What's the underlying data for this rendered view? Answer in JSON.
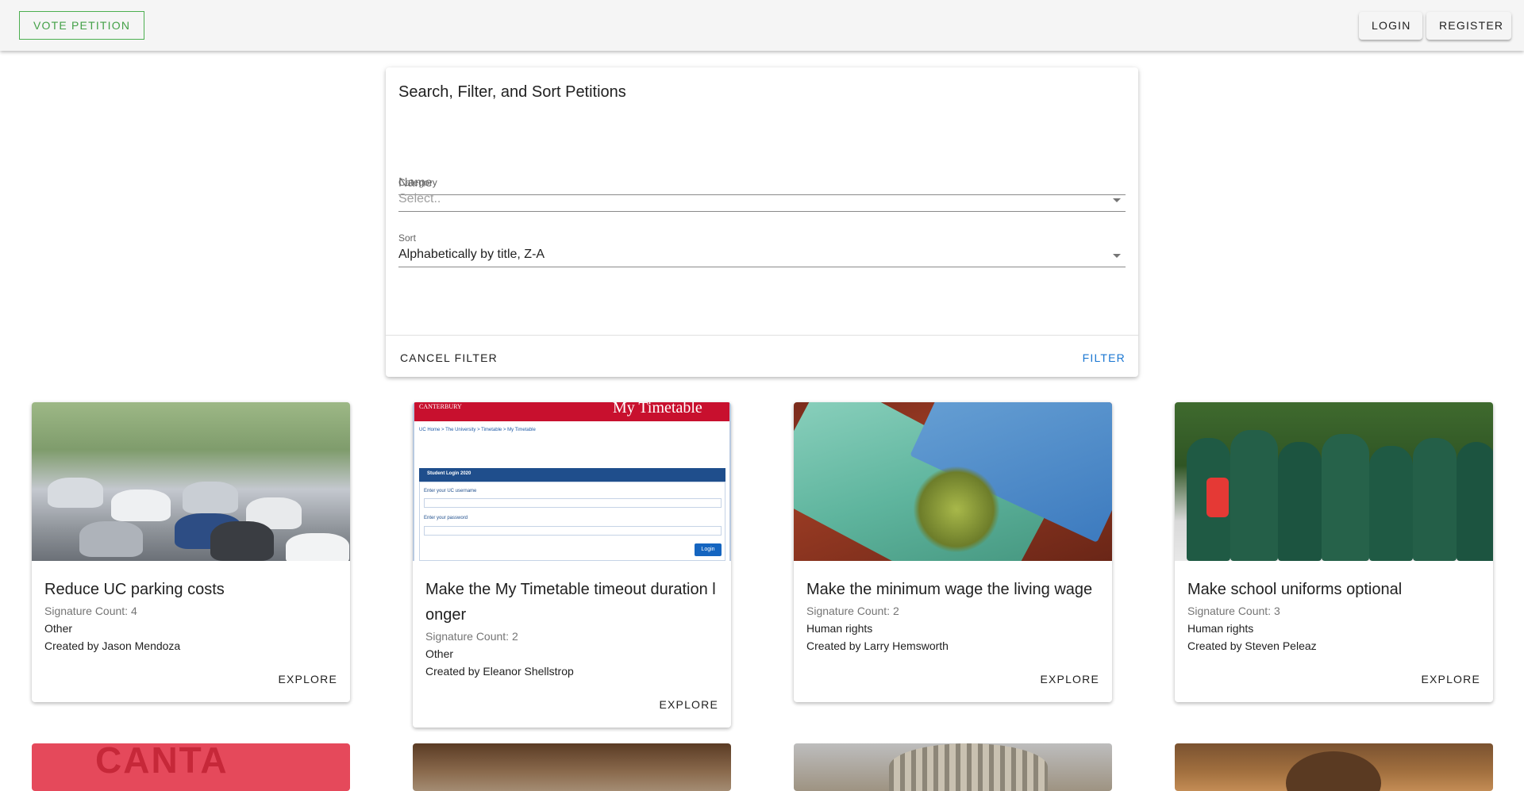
{
  "appbar": {
    "brand": "VOTE PETITION",
    "login": "LOGIN",
    "register": "REGISTER"
  },
  "filter": {
    "title": "Search, Filter, and Sort Petitions",
    "name_placeholder": "Name",
    "category_label": "Category",
    "category_value": "Select..",
    "sort_label": "Sort",
    "sort_value": "Alphabetically by title, Z-A",
    "cancel": "CANCEL FILTER",
    "apply": "FILTER"
  },
  "petitions": [
    {
      "title": "Reduce UC parking costs",
      "signatures": "Signature Count: 4",
      "category": "Other",
      "creator": "Created by Jason Mendoza",
      "action": "EXPLORE",
      "image": "parking-lot-image"
    },
    {
      "title": "Make the My Timetable timeout duration longer",
      "signatures": "Signature Count: 2",
      "category": "Other",
      "creator": "Created by Eleanor Shellstrop",
      "action": "EXPLORE",
      "image": "timetable-screenshot-image"
    },
    {
      "title": "Make the minimum wage the living wage",
      "signatures": "Signature Count: 2",
      "category": "Human rights",
      "creator": "Created by Larry Hemsworth",
      "action": "EXPLORE",
      "image": "banknotes-image"
    },
    {
      "title": "Make school uniforms optional",
      "signatures": "Signature Count: 3",
      "category": "Human rights",
      "creator": "Created by Steven Peleaz",
      "action": "EXPLORE",
      "image": "school-uniforms-image"
    }
  ],
  "timetable_image": {
    "heading": "My Timetable",
    "crumbs": "UC Home > The University > Timetable > My Timetable",
    "login_title": "Student Login 2020",
    "username_label": "Enter your UC username",
    "password_label": "Enter your password",
    "login_btn": "Login"
  },
  "bottom_row": {
    "red_banner_text": "CANTA"
  }
}
